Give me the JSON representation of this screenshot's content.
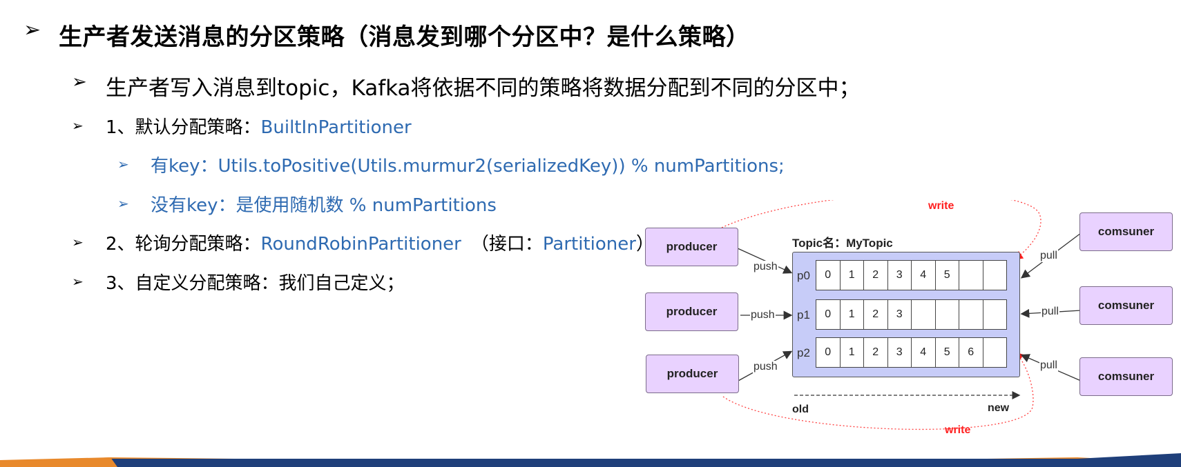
{
  "heading": {
    "bullet": "➢",
    "text": "生产者发送消息的分区策略（消息发到哪个分区中？是什么策略）"
  },
  "items": [
    {
      "bullet": "➢",
      "prefix": "",
      "text": "生产者写入消息到topic，Kafka将依据不同的策略将数据分配到不同的分区中；",
      "highlight": ""
    },
    {
      "bullet": "➢",
      "prefix": "1、默认分配策略：",
      "highlight": "BuiltInPartitioner"
    },
    {
      "bullet": "➢",
      "prefix": "有key：",
      "highlight": "Utils.toPositive(Utils.murmur2(serializedKey)) % numPartitions;"
    },
    {
      "bullet": "➢",
      "prefix": "没有key：是使用随机数 % numPartitions",
      "highlight": ""
    },
    {
      "bullet": "➢",
      "prefix": "2、轮询分配策略：",
      "highlight": "RoundRobinPartitioner",
      "suffix_a": "（接口：",
      "suffix_b": "Partitioner",
      "suffix_c": "）"
    },
    {
      "bullet": "➢",
      "prefix": "3、自定义分配策略：我们自己定义；",
      "highlight": ""
    }
  ],
  "diagram": {
    "topic_title": "Topic名：MyTopic",
    "producers": [
      "producer",
      "producer",
      "producer"
    ],
    "consumers": [
      "comsuner",
      "comsuner",
      "comsuner"
    ],
    "partitions": [
      {
        "label": "p0",
        "cells": [
          "0",
          "1",
          "2",
          "3",
          "4",
          "5",
          "",
          ""
        ]
      },
      {
        "label": "p1",
        "cells": [
          "0",
          "1",
          "2",
          "3",
          "",
          "",
          "",
          ""
        ]
      },
      {
        "label": "p2",
        "cells": [
          "0",
          "1",
          "2",
          "3",
          "4",
          "5",
          "6",
          ""
        ]
      }
    ],
    "push_label": "push",
    "pull_label": "pull",
    "write_label": "write",
    "old_label": "old",
    "new_label": "new"
  },
  "colors": {
    "accent_blue": "#2e6ab1",
    "write_red": "#ff2020",
    "box_purple": "#e9d2ff",
    "topic_fill": "#c7ccf8",
    "bar_orange": "#e8892c",
    "bar_navy": "#1f3f7a"
  }
}
